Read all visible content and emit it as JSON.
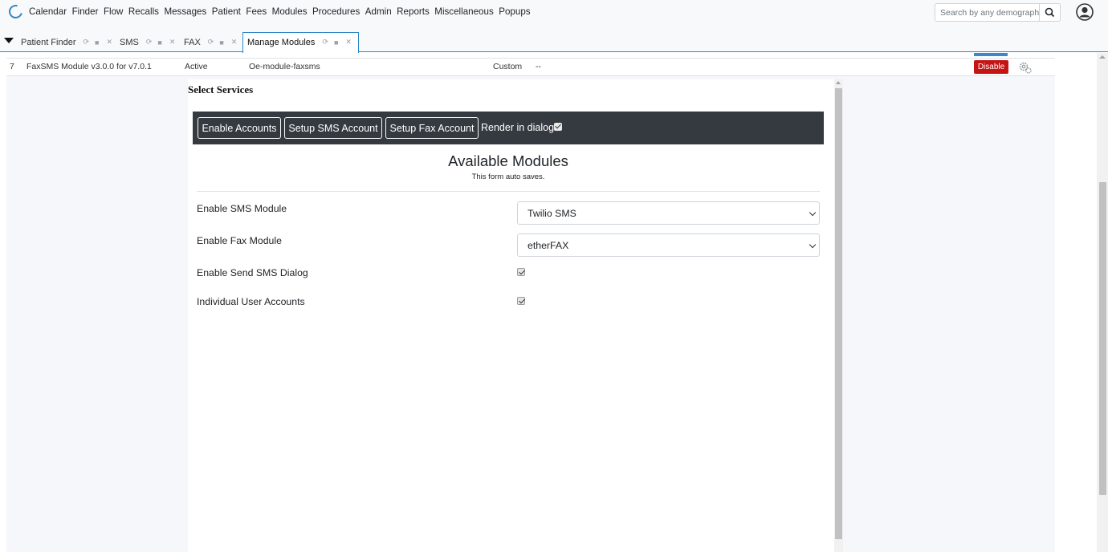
{
  "navbar": {
    "menu": [
      "Calendar",
      "Finder",
      "Flow",
      "Recalls",
      "Messages",
      "Patient",
      "Fees",
      "Modules",
      "Procedures",
      "Admin",
      "Reports",
      "Miscellaneous",
      "Popups"
    ],
    "search_placeholder": "Search by any demographics"
  },
  "tabs": [
    {
      "label": "Patient Finder"
    },
    {
      "label": "SMS"
    },
    {
      "label": "FAX"
    },
    {
      "label": "Manage Modules"
    }
  ],
  "module_row": {
    "index": "7",
    "name": "FaxSMS Module v3.0.0 for v7.0.1",
    "status": "Active",
    "directory": "Oe-module-faxsms",
    "type": "Custom",
    "dash": "--",
    "disable_label": "Disable"
  },
  "frame": {
    "title": "Select Services",
    "toolbar": {
      "enable_accounts": "Enable Accounts",
      "setup_sms": "Setup SMS Account",
      "setup_fax": "Setup Fax Account",
      "render_label": "Render in dialog."
    },
    "heading": "Available Modules",
    "subheading": "This form auto saves.",
    "fields": {
      "sms_label": "Enable SMS Module",
      "sms_value": "Twilio SMS",
      "fax_label": "Enable Fax Module",
      "fax_value": "etherFAX",
      "send_dialog_label": "Enable Send SMS Dialog",
      "individual_label": "Individual User Accounts"
    }
  },
  "colors": {
    "accent": "#2f86c6",
    "danger": "#c41414",
    "toolbar_dark": "#343a40"
  }
}
